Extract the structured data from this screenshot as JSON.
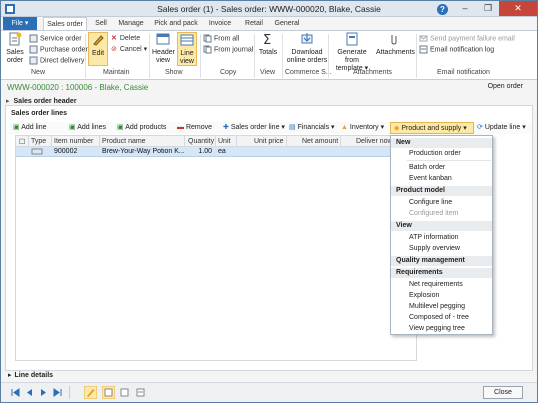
{
  "window": {
    "title": "Sales order (1) - Sales order: WWW-000020, Blake, Cassie",
    "minimize": "–",
    "maximize": "❐",
    "close": "✕",
    "help": "?"
  },
  "ribbon_tabs": [
    "File",
    "Sales order",
    "Sell",
    "Manage",
    "Pick and pack",
    "Invoice",
    "Retail",
    "General"
  ],
  "file_arrow": "▾",
  "ribbon": {
    "new": {
      "label": "New",
      "sales_order_line1": "Sales",
      "sales_order_line2": "order",
      "service_order": "Service order",
      "purchase_order": "Purchase order",
      "direct_delivery": "Direct delivery"
    },
    "maintain": {
      "label": "Maintain",
      "edit": "Edit",
      "delete": "Delete",
      "cancel": "Cancel"
    },
    "show": {
      "label": "Show",
      "header_view_1": "Header",
      "header_view_2": "view",
      "line_view_1": "Line",
      "line_view_2": "view"
    },
    "copy": {
      "label": "Copy",
      "from_all": "From all",
      "from_journal": "From journal"
    },
    "view": {
      "label": "View",
      "totals": "Totals"
    },
    "commerce": {
      "label": "Commerce S...",
      "download_1": "Download",
      "download_2": "online orders"
    },
    "attachments": {
      "label": "Attachments",
      "generate_1": "Generate from",
      "generate_2": "template",
      "attachments": "Attachments"
    },
    "email": {
      "label": "Email notification",
      "send_payment_failure": "Send payment failure email",
      "email_log": "Email notification log"
    }
  },
  "record": {
    "id": "WWW-000020 : 100006 - Blake, Cassie",
    "status": "Open order"
  },
  "sections": {
    "header": "Sales order header",
    "lines": "Sales order lines",
    "line_details": "Line details"
  },
  "lines_toolbar": {
    "add_line": "Add line",
    "add_lines": "Add lines",
    "add_products": "Add products",
    "remove": "Remove",
    "sales_order_line": "Sales order line",
    "financials": "Financials",
    "inventory": "Inventory",
    "product_and_supply": "Product and supply",
    "update_line": "Update line"
  },
  "grid": {
    "columns": [
      "Type",
      "Item number",
      "Product name",
      "Quantity",
      "Unit",
      "Unit price",
      "Net amount",
      "Deliver now"
    ],
    "rows": [
      {
        "item_number": "900002",
        "product_name": "Brew-Your-Way Potion K...",
        "quantity": "1.00",
        "unit": "ea"
      }
    ]
  },
  "menu": {
    "groups": [
      {
        "header": "New",
        "items": [
          {
            "label": "Production order",
            "enabled": true
          },
          {
            "label": "Batch order",
            "enabled": true
          },
          {
            "label": "Event kanban",
            "enabled": true
          }
        ]
      },
      {
        "header": "Product model",
        "items": [
          {
            "label": "Configure line",
            "enabled": true
          },
          {
            "label": "Configured item",
            "enabled": false
          }
        ]
      },
      {
        "header": "View",
        "items": [
          {
            "label": "ATP information",
            "enabled": true
          },
          {
            "label": "Supply overview",
            "enabled": true
          }
        ]
      },
      {
        "header": "Quality management",
        "items": []
      },
      {
        "header": "Requirements",
        "items": [
          {
            "label": "Net requirements",
            "enabled": true
          },
          {
            "label": "Explosion",
            "enabled": true
          },
          {
            "label": "Multilevel pegging",
            "enabled": true
          },
          {
            "label": "Composed of - tree",
            "enabled": true
          },
          {
            "label": "View pegging tree",
            "enabled": true
          }
        ]
      }
    ]
  },
  "footer": {
    "close": "Close"
  },
  "colors": {
    "accent": "#2b6fb6",
    "highlight": "#fde9a6",
    "record_green": "#3a8b3a",
    "selected_row": "#d4e6f7"
  }
}
